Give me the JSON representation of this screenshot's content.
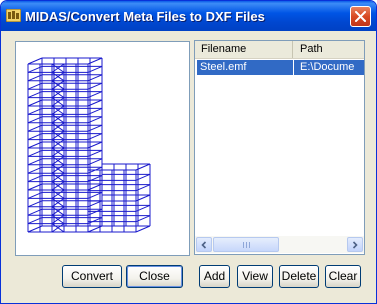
{
  "window": {
    "title": "MIDAS/Convert Meta Files to DXF Files",
    "icon": "midas-app-icon",
    "close_icon": "close-icon"
  },
  "preview": {
    "description_icon": "structure-preview-icon"
  },
  "file_list": {
    "columns": [
      {
        "label": "Filename"
      },
      {
        "label": "Path"
      }
    ],
    "rows": [
      {
        "filename": "Steel.emf",
        "path": "E:\\Docume",
        "selected": true
      }
    ],
    "selection_color": "#316ac5"
  },
  "buttons": {
    "convert": "Convert",
    "close": "Close",
    "add": "Add",
    "view": "View",
    "delete": "Delete",
    "clear": "Clear"
  },
  "colors": {
    "title_bar": "#0055e5",
    "client_bg": "#ece9d8",
    "structure_lines": "#1a1acc"
  }
}
